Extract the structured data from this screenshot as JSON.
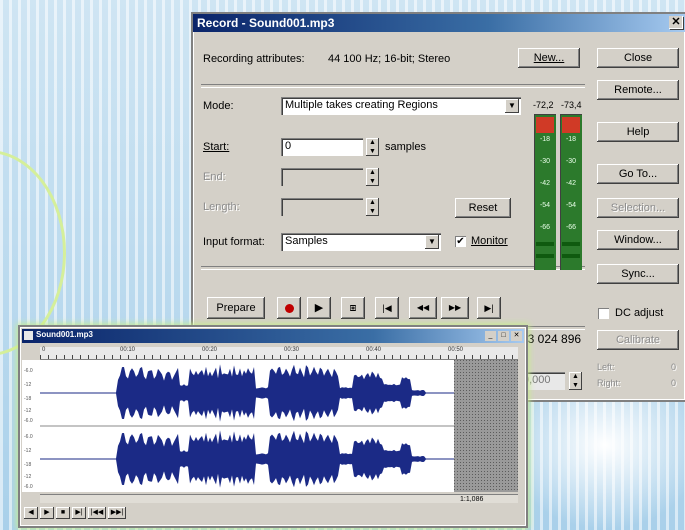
{
  "background": {
    "stripe_color": "#bcd9ec",
    "accent": "#d5ef9a"
  },
  "record_dialog": {
    "title": "Record - Sound001.mp3",
    "close_glyph": "✕",
    "attributes_label": "Recording attributes:",
    "attributes_value": "44 100 Hz; 16-bit; Stereo",
    "new_button": "New...",
    "mode_label": "Mode:",
    "mode_value": "Multiple takes creating Regions",
    "start_label": "Start:",
    "start_value": "0",
    "start_unit": "samples",
    "end_label": "End:",
    "length_label": "Length:",
    "reset_button": "Reset",
    "input_format_label": "Input format:",
    "input_format_value": "Samples",
    "monitor_label": "Monitor",
    "monitor_checked": true,
    "transport": {
      "prepare": "Prepare",
      "record_icon": "record-dot-icon",
      "play": "▶",
      "stop": "⧆",
      "go_start": "|◀",
      "rewind": "◀◀",
      "forward": "▶▶",
      "go_end": "▶|"
    },
    "side_buttons": {
      "close": "Close",
      "remote": "Remote...",
      "help": "Help",
      "goto": "Go To...",
      "selection": "Selection...",
      "window": "Window...",
      "sync": "Sync..."
    },
    "dc_adjust": "DC adjust",
    "dc_checked": false,
    "calibrate_button": "Calibrate",
    "meters": {
      "left_peak": "-72,2",
      "right_peak": "-73,4",
      "ticks": [
        "-6",
        "-18",
        "-30",
        "-42",
        "-54",
        "-66"
      ]
    },
    "time_value": "03 024 896",
    "offset_value": "0,000",
    "left_label": "Left:",
    "right_label": "Right:",
    "left_value": "0",
    "right_value": "0"
  },
  "sound_window": {
    "title": "Sound001.mp3",
    "ruler_ticks": [
      "0",
      "00:10",
      "00:20",
      "00:30",
      "00:40",
      "00:50",
      "01:00"
    ],
    "amp_ticks": [
      "-6.0",
      "-12",
      "-18",
      "-12",
      "-6.0",
      "-6.0",
      "-12",
      "-18",
      "-12",
      "-6.0"
    ],
    "zoom_label": "1:1,086",
    "status_buttons": [
      "◀",
      "▶",
      "■",
      "▶|",
      "|◀◀",
      "▶▶|"
    ],
    "wave_color": "#1b2a86"
  }
}
